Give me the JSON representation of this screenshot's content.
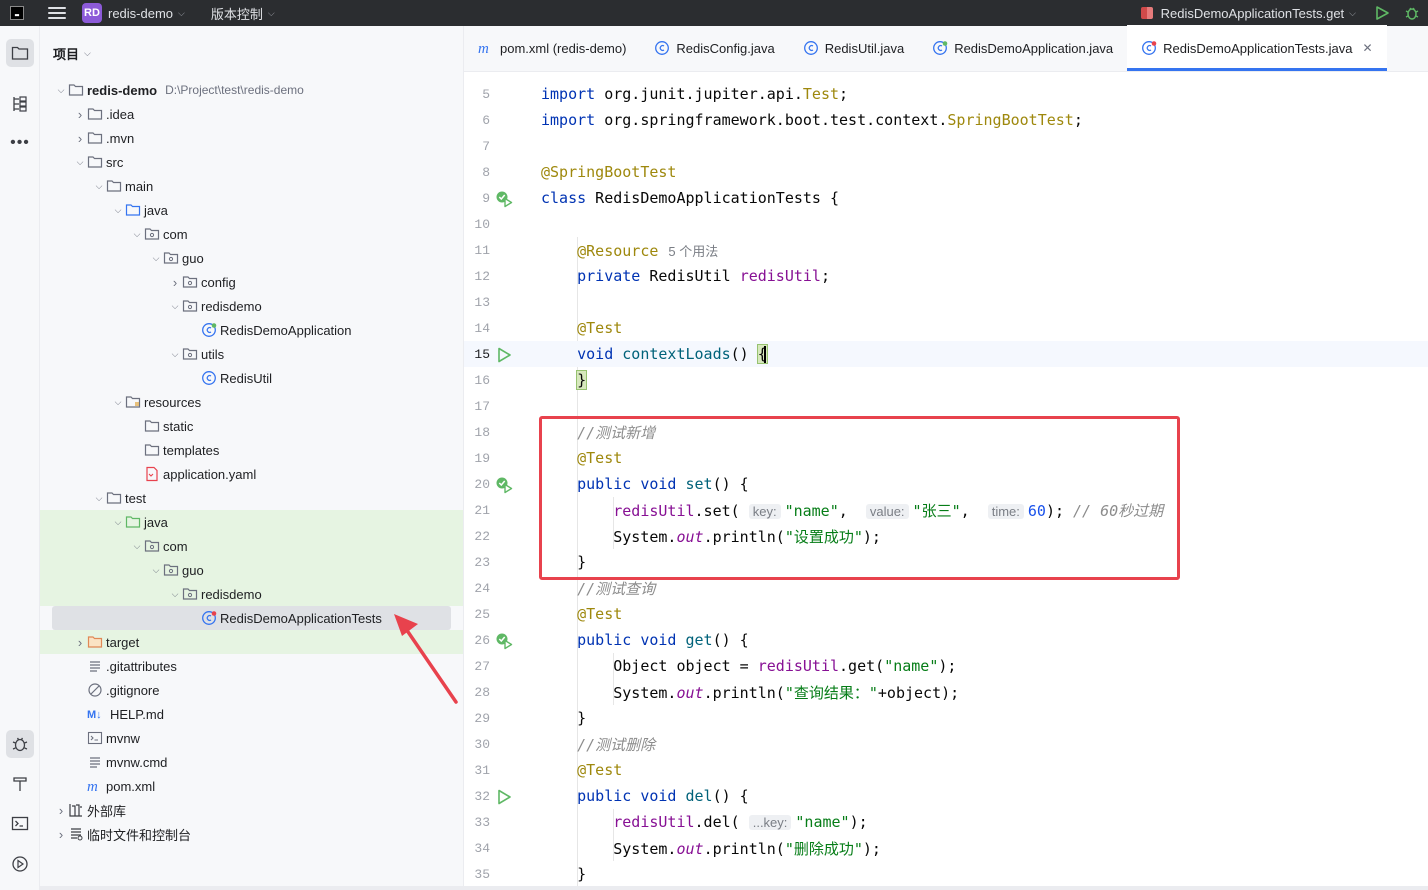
{
  "titlebar": {
    "app_icon": "jetbrains-logo",
    "project_badge": "RD",
    "project_name": "redis-demo",
    "vcs_label": "版本控制",
    "run_config": "RedisDemoApplicationTests.get"
  },
  "project_panel": {
    "title": "项目",
    "tree": [
      {
        "label": "redis-demo",
        "hint": "D:\\Project\\test\\redis-demo",
        "icon": "folder-icon",
        "expanded": true
      },
      {
        "label": ".idea",
        "icon": "folder-icon"
      },
      {
        "label": ".mvn",
        "icon": "folder-icon"
      },
      {
        "label": "src",
        "icon": "folder-icon",
        "expanded": true
      },
      {
        "label": "main",
        "icon": "folder-icon",
        "expanded": true
      },
      {
        "label": "java",
        "icon": "source-folder-icon",
        "expanded": true
      },
      {
        "label": "com",
        "icon": "package-icon",
        "expanded": true
      },
      {
        "label": "guo",
        "icon": "package-icon",
        "expanded": true
      },
      {
        "label": "config",
        "icon": "package-icon"
      },
      {
        "label": "redisdemo",
        "icon": "package-icon",
        "expanded": true
      },
      {
        "label": "RedisDemoApplication",
        "icon": "spring-class-icon"
      },
      {
        "label": "utils",
        "icon": "package-icon",
        "expanded": true
      },
      {
        "label": "RedisUtil",
        "icon": "class-icon"
      },
      {
        "label": "resources",
        "icon": "resources-folder-icon",
        "expanded": true
      },
      {
        "label": "static",
        "icon": "folder-icon"
      },
      {
        "label": "templates",
        "icon": "folder-icon"
      },
      {
        "label": "application.yaml",
        "icon": "yaml-file-icon"
      },
      {
        "label": "test",
        "icon": "folder-icon",
        "expanded": true
      },
      {
        "label": "java",
        "icon": "test-source-folder-icon",
        "expanded": true
      },
      {
        "label": "com",
        "icon": "package-icon",
        "expanded": true
      },
      {
        "label": "guo",
        "icon": "package-icon",
        "expanded": true
      },
      {
        "label": "redisdemo",
        "icon": "package-icon",
        "expanded": true
      },
      {
        "label": "RedisDemoApplicationTests",
        "icon": "spring-test-class-icon"
      },
      {
        "label": "target",
        "icon": "excluded-folder-icon"
      },
      {
        "label": ".gitattributes",
        "icon": "text-file-icon"
      },
      {
        "label": ".gitignore",
        "icon": "ignore-file-icon"
      },
      {
        "label": "HELP.md",
        "icon": "markdown-file-icon"
      },
      {
        "label": "mvnw",
        "icon": "shell-file-icon"
      },
      {
        "label": "mvnw.cmd",
        "icon": "text-file-icon"
      },
      {
        "label": "pom.xml",
        "icon": "maven-icon"
      },
      {
        "label": "外部库",
        "icon": "library-icon"
      },
      {
        "label": "临时文件和控制台",
        "icon": "scratches-icon"
      }
    ]
  },
  "tabs": [
    {
      "label": "pom.xml (redis-demo)",
      "icon": "maven-icon"
    },
    {
      "label": "RedisConfig.java",
      "icon": "class-icon"
    },
    {
      "label": "RedisUtil.java",
      "icon": "class-icon"
    },
    {
      "label": "RedisDemoApplication.java",
      "icon": "spring-class-icon"
    },
    {
      "label": "RedisDemoApplicationTests.java",
      "icon": "spring-test-class-icon",
      "active": true
    }
  ],
  "editor": {
    "line_numbers": [
      "5",
      "6",
      "7",
      "8",
      "9",
      "10",
      "11",
      "12",
      "13",
      "14",
      "15",
      "16",
      "17",
      "18",
      "19",
      "20",
      "21",
      "22",
      "23",
      "24",
      "25",
      "26",
      "27",
      "28",
      "29",
      "30",
      "31",
      "32",
      "33",
      "34",
      "35"
    ],
    "tokens": {
      "import": "import",
      "l5_pkg": "org.junit.jupiter.api.",
      "l5_cls": "Test",
      "l6_pkg": "org.springframework.boot.test.context.",
      "l6_cls": "SpringBootTest",
      "semi": ";",
      "l8_ann": "@SpringBootTest",
      "class_kw": "class",
      "class_name": " RedisDemoApplicationTests {",
      "resource_ann": "@Resource",
      "usages": "5 个用法",
      "private_kw": "private",
      "redisutil_type": " RedisUtil ",
      "redisutil_field": "redisUtil",
      "test_ann": "@Test",
      "void_kw": "void",
      "public_kw": "public",
      "context_loads": "contextLoads",
      "parens": "() ",
      "brace_open": "{",
      "brace_close": "}",
      "cmt_add": "//测试新增",
      "set_fn": "set",
      "hint_key": "key:",
      "hint_value": "value:",
      "hint_time": "time:",
      "hint_key_short": "...key:",
      "str_name": "\"name\"",
      "str_zhangsan": "\"张三\"",
      "num_60": "60",
      "cmt_60": "// 60秒过期",
      "system": "System.",
      "out": "out",
      "println": ".println(",
      "str_set_ok": "\"设置成功\"",
      "cmt_query": "//测试查询",
      "get_fn": "get",
      "object_decl": "Object object = ",
      "get_call": ".get(",
      "str_query": "\"查询结果：\"",
      "plus_obj": "+object);",
      "cmt_del": "//测试删除",
      "del_fn": "del",
      "del_call": ".del(",
      "str_del_ok": "\"删除成功\"",
      "set_call": ".set(",
      "close_paren_semi": ");",
      "comma": ", ",
      "open_call": "() {"
    }
  },
  "annotation": {
    "highlight_box_color": "#e8424d",
    "arrow_color": "#e8424d"
  }
}
